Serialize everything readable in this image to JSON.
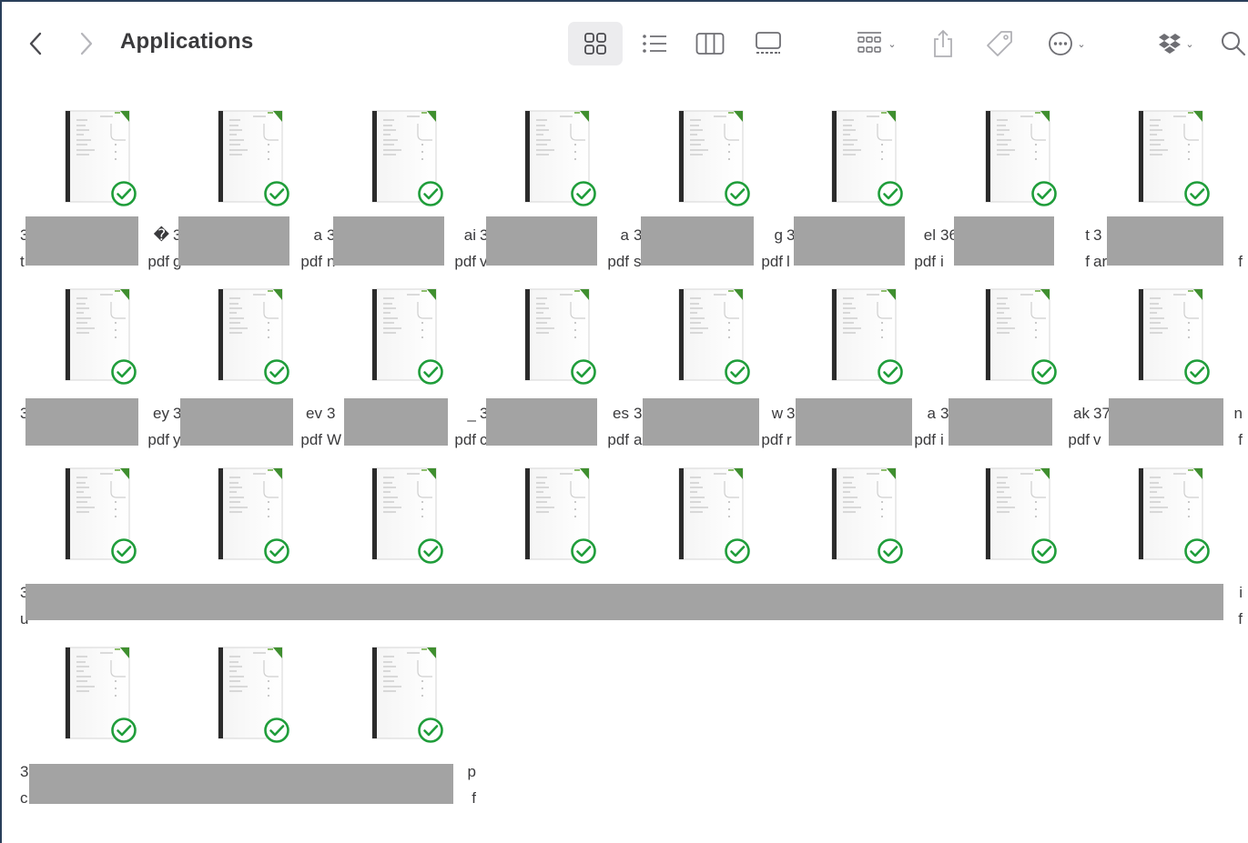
{
  "window": {
    "title": "Applications"
  },
  "toolbar": {
    "back_icon": "chevron-left-icon",
    "forward_icon": "chevron-right-icon",
    "views": [
      "icon-view",
      "list-view",
      "column-view",
      "gallery-view"
    ],
    "selected_view": "icon-view",
    "group_icon": "group-by-icon",
    "share_icon": "share-icon",
    "tag_icon": "tag-icon",
    "more_icon": "ellipsis-circle-icon",
    "dropbox_icon": "dropbox-icon",
    "search_icon": "search-icon"
  },
  "colors": {
    "check": "#1f9d3a",
    "redaction": "#a3a3a3",
    "doc_accent": "#3f8f2f"
  },
  "files": [
    {
      "l1a": "3",
      "l1b": "�",
      "l2a": "t",
      "l2b": "pdf"
    },
    {
      "l1a": "3",
      "l1b": "a",
      "l2a": "g",
      "l2b": "pdf"
    },
    {
      "l1a": "3",
      "l1b": "ai",
      "l2a": "n",
      "l2b": "pdf"
    },
    {
      "l1a": "3",
      "l1b": "a",
      "l2a": "v",
      "l2b": "pdf"
    },
    {
      "l1a": "3",
      "l1b": "g",
      "l2a": "s",
      "l2b": "pdf"
    },
    {
      "l1a": "3",
      "l1b": "el",
      "l2a": "l",
      "l2b": "pdf"
    },
    {
      "l1a": "36",
      "l1b": "t",
      "l2a": "i",
      "l2b": "f"
    },
    {
      "l1a": "3",
      "l1b": "",
      "l2a": "ar",
      "l2b": "f"
    },
    {
      "l1a": "3",
      "l1b": "ey",
      "l2a": "",
      "l2b": "pdf"
    },
    {
      "l1a": "3",
      "l1b": "ev",
      "l2a": "y",
      "l2b": "pdf"
    },
    {
      "l1a": "3",
      "l1b": "_",
      "l2a": "W",
      "l2b": "pdf"
    },
    {
      "l1a": "3",
      "l1b": "es",
      "l2a": "c",
      "l2b": "pdf"
    },
    {
      "l1a": "3",
      "l1b": "w",
      "l2a": "a",
      "l2b": "pdf"
    },
    {
      "l1a": "3",
      "l1b": "a",
      "l2a": "r",
      "l2b": "pdf"
    },
    {
      "l1a": "3",
      "l1b": "ak",
      "l2a": "i",
      "l2b": "pdf"
    },
    {
      "l1a": "37",
      "l1b": "n",
      "l2a": "v",
      "l2b": "f"
    },
    {
      "l1a": "3",
      "l1b": "",
      "l2a": "u",
      "l2b": ""
    },
    {
      "l1a": "",
      "l1b": "",
      "l2a": "",
      "l2b": ""
    },
    {
      "l1a": "",
      "l1b": "",
      "l2a": "",
      "l2b": ""
    },
    {
      "l1a": "",
      "l1b": "",
      "l2a": "",
      "l2b": ""
    },
    {
      "l1a": "",
      "l1b": "",
      "l2a": "",
      "l2b": ""
    },
    {
      "l1a": "",
      "l1b": "",
      "l2a": "",
      "l2b": ""
    },
    {
      "l1a": "",
      "l1b": "",
      "l2a": "",
      "l2b": ""
    },
    {
      "l1a": "",
      "l1b": "i",
      "l2a": "",
      "l2b": "f"
    },
    {
      "l1a": "3",
      "l1b": "",
      "l2a": "c",
      "l2b": ""
    },
    {
      "l1a": "",
      "l1b": "",
      "l2a": "",
      "l2b": ""
    },
    {
      "l1a": "",
      "l1b": "p",
      "l2a": "",
      "l2b": "f"
    }
  ]
}
